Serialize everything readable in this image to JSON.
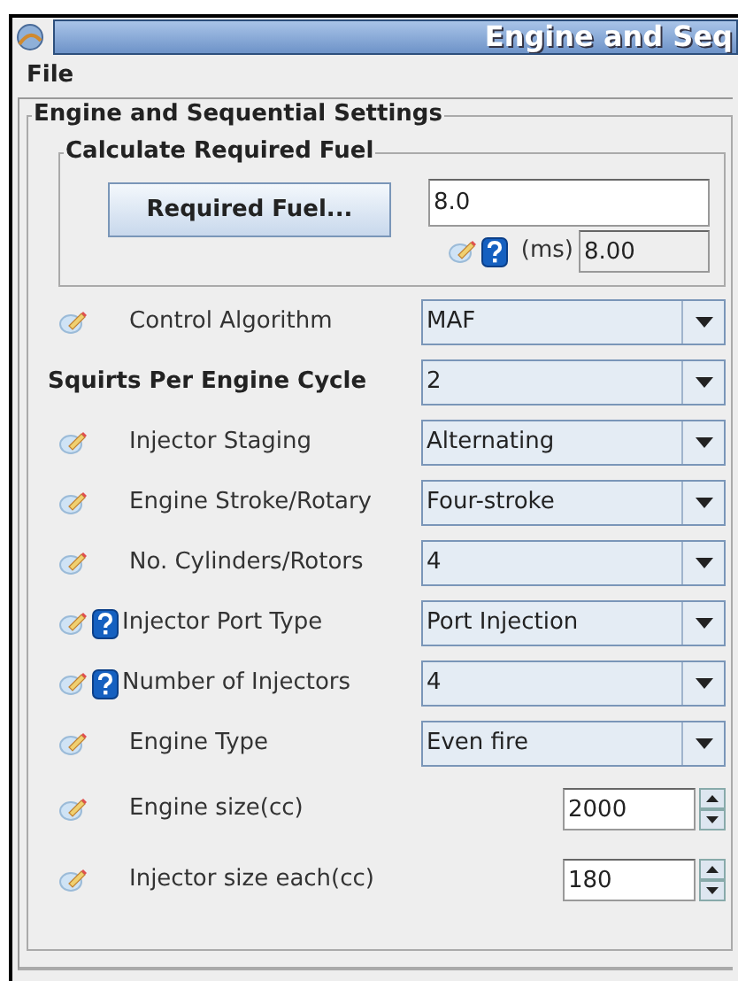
{
  "window": {
    "title": "Engine and Seq"
  },
  "menu": [
    "File"
  ],
  "panel": {
    "title": "Engine and Sequential Settings",
    "fuel_group": {
      "title": "Calculate Required Fuel",
      "button": "Required Fuel...",
      "value": "8.0",
      "unit": "(ms)",
      "result": "8.00"
    },
    "rows": [
      {
        "label": "Control Algorithm",
        "kind": "combo",
        "value": "MAF",
        "pencil": true,
        "help": false,
        "bold": false
      },
      {
        "label": "Squirts Per Engine Cycle",
        "kind": "combo",
        "value": "2",
        "pencil": false,
        "help": false,
        "bold": true
      },
      {
        "label": "Injector Staging",
        "kind": "combo",
        "value": "Alternating",
        "pencil": true,
        "help": false,
        "bold": false
      },
      {
        "label": "Engine Stroke/Rotary",
        "kind": "combo",
        "value": "Four-stroke",
        "pencil": true,
        "help": false,
        "bold": false
      },
      {
        "label": "No. Cylinders/Rotors",
        "kind": "combo",
        "value": "4",
        "pencil": true,
        "help": false,
        "bold": false
      },
      {
        "label": "Injector Port Type",
        "kind": "combo",
        "value": "Port Injection",
        "pencil": true,
        "help": true,
        "bold": false
      },
      {
        "label": "Number of Injectors",
        "kind": "combo",
        "value": "4",
        "pencil": true,
        "help": true,
        "bold": false
      },
      {
        "label": "Engine Type",
        "kind": "combo",
        "value": "Even fire",
        "pencil": true,
        "help": false,
        "bold": false
      },
      {
        "label": "Engine size(cc)",
        "kind": "spinner",
        "value": "2000",
        "pencil": true,
        "help": false,
        "bold": false
      },
      {
        "label": "Injector size each(cc)",
        "kind": "spinner",
        "value": "180",
        "pencil": true,
        "help": false,
        "bold": false
      }
    ]
  }
}
